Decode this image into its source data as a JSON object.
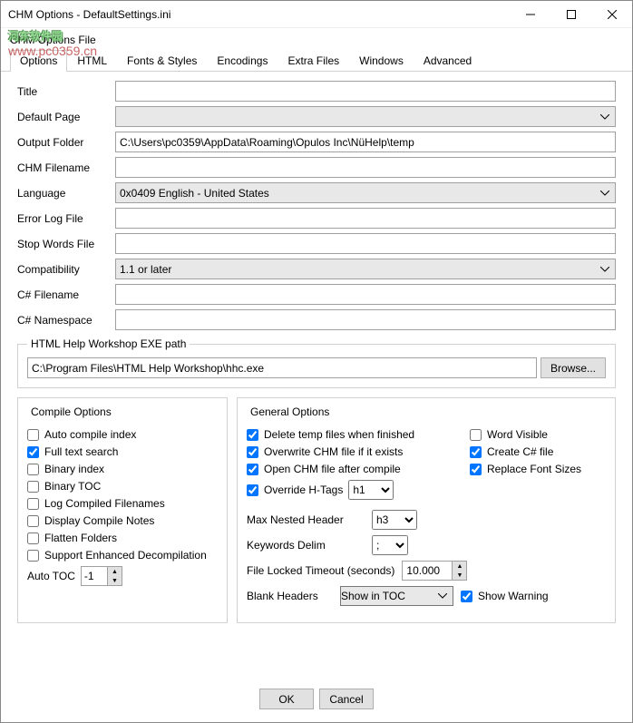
{
  "window": {
    "title": "CHM Options  - DefaultSettings.ini"
  },
  "watermark": {
    "text": "河东软件园",
    "url": "www.pc0359.cn"
  },
  "subtitle": "CHM Options File",
  "tabs": [
    "Options",
    "HTML",
    "Fonts & Styles",
    "Encodings",
    "Extra Files",
    "Windows",
    "Advanced"
  ],
  "form": {
    "title_lbl": "Title",
    "title_val": "",
    "defpage_lbl": "Default Page",
    "defpage_val": "",
    "outfolder_lbl": "Output Folder",
    "outfolder_val": "C:\\Users\\pc0359\\AppData\\Roaming\\Opulos Inc\\NüHelp\\temp",
    "chmfile_lbl": "CHM Filename",
    "chmfile_val": "",
    "lang_lbl": "Language",
    "lang_val": "0x0409 English - United States",
    "errlog_lbl": "Error Log File",
    "errlog_val": "",
    "stopwords_lbl": "Stop Words File",
    "stopwords_val": "",
    "compat_lbl": "Compatibility",
    "compat_val": "1.1 or later",
    "csfile_lbl": "C# Filename",
    "csfile_val": "",
    "csns_lbl": "C# Namespace",
    "csns_val": ""
  },
  "exepath": {
    "legend": "HTML Help Workshop EXE path",
    "value": "C:\\Program Files\\HTML Help Workshop\\hhc.exe",
    "browse": "Browse..."
  },
  "compile": {
    "legend": "Compile Options",
    "auto_compile": "Auto compile index",
    "fulltext": "Full text search",
    "binidx": "Binary index",
    "bintoc": "Binary TOC",
    "logfn": "Log Compiled Filenames",
    "dispnotes": "Display Compile Notes",
    "flatten": "Flatten Folders",
    "enhdecomp": "Support Enhanced Decompilation",
    "autotoc_lbl": "Auto TOC",
    "autotoc_val": "-1"
  },
  "general": {
    "legend": "General Options",
    "deltemp": "Delete temp files when finished",
    "overwrite": "Overwrite CHM file if it exists",
    "openchm": "Open CHM file after compile",
    "override_h": "Override H-Tags",
    "override_h_val": "h1",
    "wordvis": "Word Visible",
    "createcs": "Create C# file",
    "replfont": "Replace Font Sizes",
    "maxnest_lbl": "Max Nested Header",
    "maxnest_val": "h3",
    "kwdelim_lbl": "Keywords Delim",
    "kwdelim_val": ";",
    "filelock_lbl": "File Locked Timeout (seconds)",
    "filelock_val": "10.000",
    "blankhdr_lbl": "Blank Headers",
    "blankhdr_val": "Show in TOC",
    "showwarn": "Show Warning"
  },
  "buttons": {
    "ok": "OK",
    "cancel": "Cancel"
  }
}
